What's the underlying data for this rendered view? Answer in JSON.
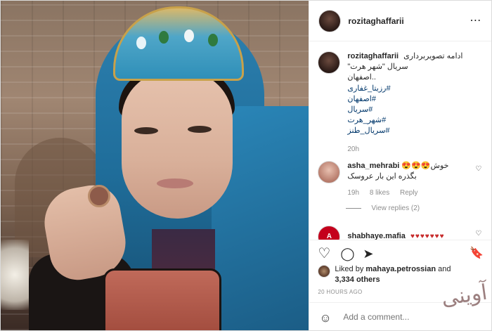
{
  "header": {
    "username": "rozitaghaffarii",
    "more_icon": "⋯"
  },
  "caption": {
    "username": "rozitaghaffarii",
    "lines": [
      "ادامه تصویربرداری",
      "سریال \"شهر هرت\"",
      "..اصفهان",
      "#رزیتا_غفاری",
      "#اصفهان",
      "#سریال",
      "#شهر_هرت",
      "#سریال_طنز"
    ],
    "time": "20h"
  },
  "comment1": {
    "username": "asha_mehrabi",
    "line1": "خوش😍😍😍",
    "line2": "بگذره این بار عروسک",
    "time": "19h",
    "likes": "8 likes",
    "reply": "Reply",
    "heart_icon": "♡"
  },
  "replies": {
    "label": "View replies (2)"
  },
  "comment2": {
    "username": "shabhaye.mafia",
    "hearts": "♥♥♥♥♥♥♥",
    "avatar_text": "A",
    "heart_icon": "♡"
  },
  "actions": {
    "like_icon": "♡",
    "comment_icon": "◯",
    "share_icon": "➤",
    "save_icon": "🔖"
  },
  "likes": {
    "prefix": "Liked by ",
    "user": "mahaya.petrossian",
    "and": " and",
    "others": "3,334 others"
  },
  "timestamp": "20 HOURS AGO",
  "add_comment": {
    "placeholder": "Add a comment...",
    "emoji_icon": "☺"
  },
  "watermark": "آوینی"
}
